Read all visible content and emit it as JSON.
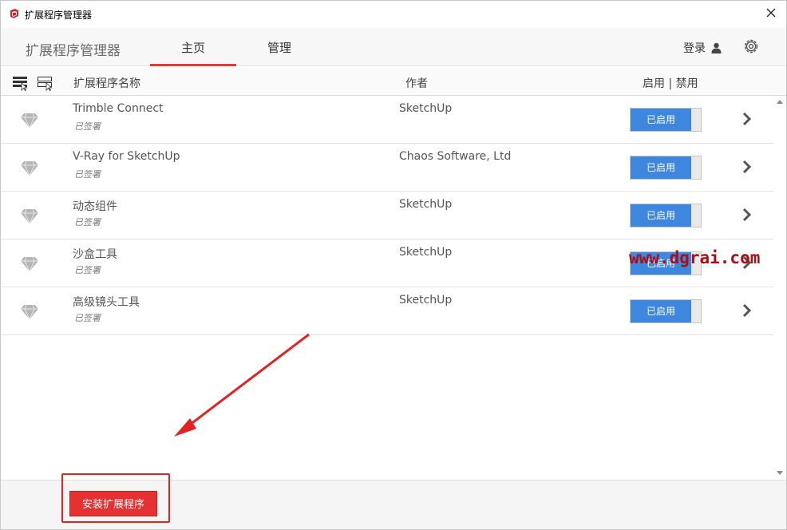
{
  "window": {
    "title": "扩展程序管理器",
    "icon": "sketchup-icon"
  },
  "header": {
    "app_name": "扩展程序管理器",
    "tabs": [
      {
        "label": "主页",
        "active": true
      },
      {
        "label": "管理",
        "active": false
      }
    ],
    "login_label": "登录"
  },
  "columns": {
    "name": "扩展程序名称",
    "author": "作者",
    "status": "启用 | 禁用"
  },
  "extensions": [
    {
      "name": "Trimble Connect",
      "signed": "已签署",
      "author": "SketchUp",
      "toggle_label": "已启用"
    },
    {
      "name": "V-Ray for SketchUp",
      "signed": "已签署",
      "author": "Chaos Software, Ltd",
      "toggle_label": "已启用"
    },
    {
      "name": "动态组件",
      "signed": "已签署",
      "author": "SketchUp",
      "toggle_label": "已启用"
    },
    {
      "name": "沙盒工具",
      "signed": "已签署",
      "author": "SketchUp",
      "toggle_label": "已启用"
    },
    {
      "name": "高级镜头工具",
      "signed": "已签署",
      "author": "SketchUp",
      "toggle_label": "已启用"
    }
  ],
  "footer": {
    "install_label": "安装扩展程序"
  },
  "watermark": "www.dgrai.com",
  "colors": {
    "accent_red": "#e03a3a",
    "toggle_blue": "#3e86de",
    "annotation_red": "#e52222"
  }
}
